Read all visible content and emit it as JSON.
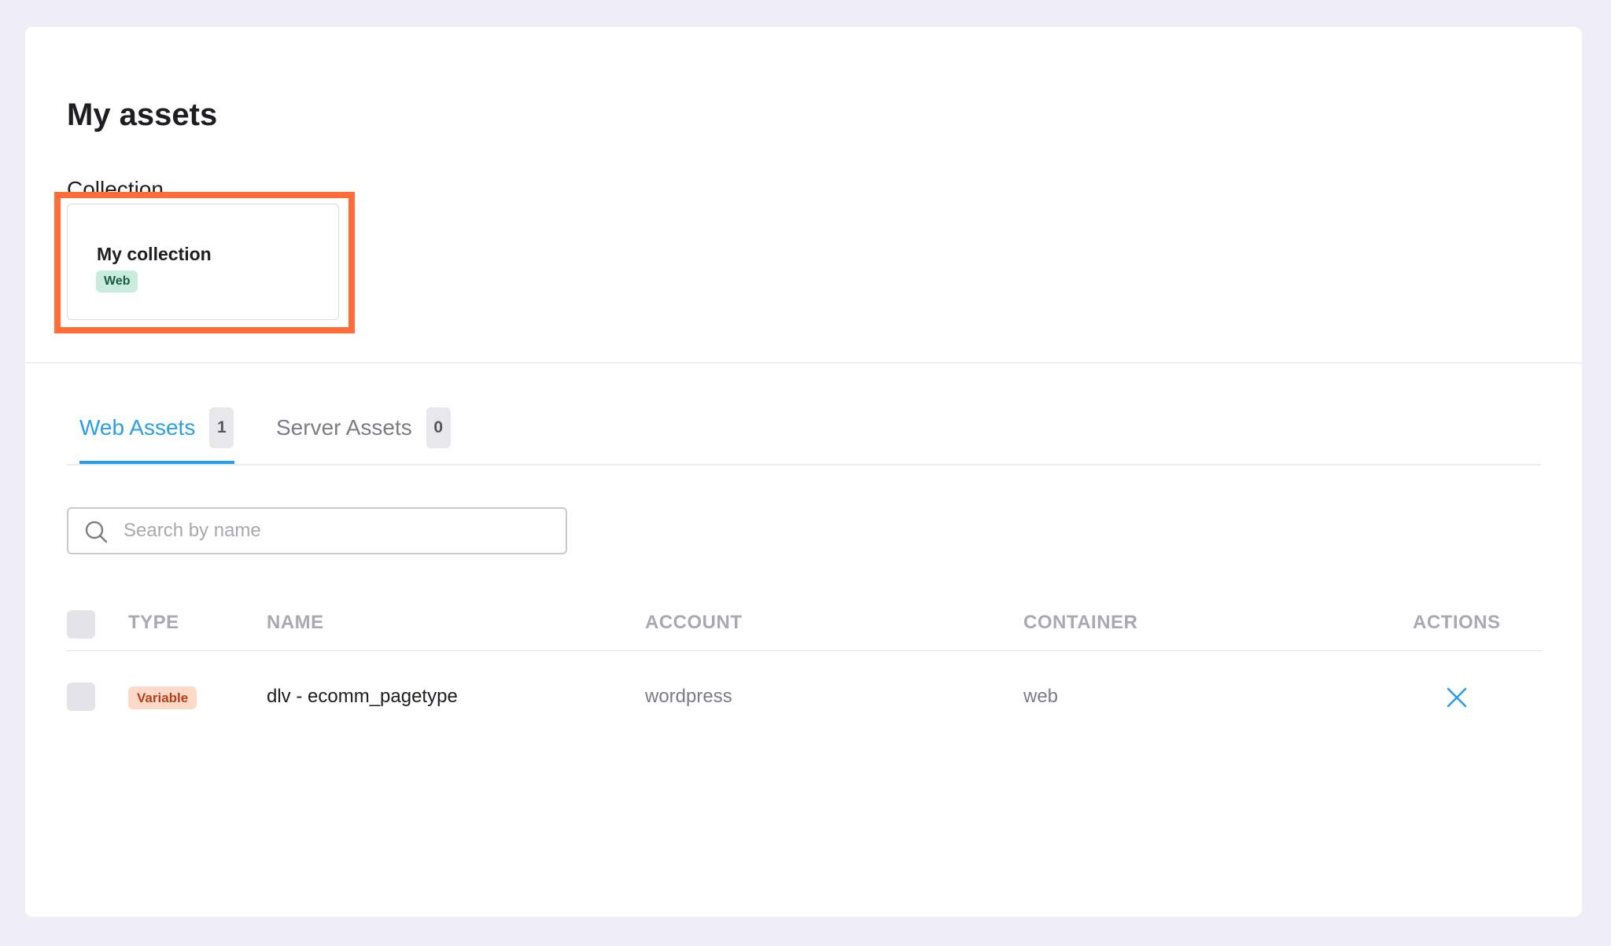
{
  "page": {
    "title": "My assets"
  },
  "collection": {
    "section_label": "Collection",
    "card": {
      "name": "My collection",
      "badge": "Web"
    }
  },
  "tabs": [
    {
      "label": "Web Assets",
      "count": "1",
      "active": true
    },
    {
      "label": "Server Assets",
      "count": "0",
      "active": false
    }
  ],
  "search": {
    "placeholder": "Search by name",
    "value": ""
  },
  "table": {
    "columns": [
      "TYPE",
      "NAME",
      "ACCOUNT",
      "CONTAINER",
      "ACTIONS"
    ],
    "rows": [
      {
        "type": "Variable",
        "name": "dlv - ecomm_pagetype",
        "account": "wordpress",
        "container": "web",
        "action_icon": "close-icon"
      }
    ]
  },
  "colors": {
    "accent": "#2a9fe6",
    "highlight": "#ff6c37",
    "web_badge_bg": "#c9ecdf",
    "variable_badge_bg": "#fdd9c8"
  }
}
